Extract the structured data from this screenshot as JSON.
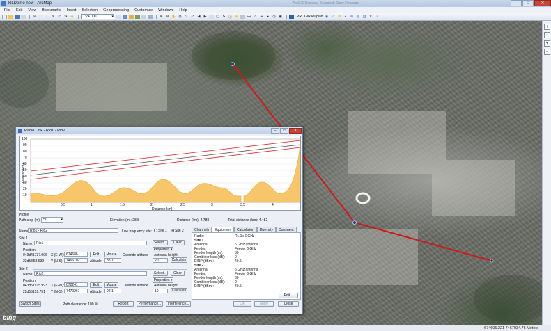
{
  "window": {
    "title": "RLDemo new - ArcMap",
    "faint_title": "ArcGIS Desktop - Microsoft Store Rewards"
  },
  "menu": [
    "File",
    "Edit",
    "View",
    "Bookmarks",
    "Insert",
    "Selection",
    "Geoprocessing",
    "Customize",
    "Windows",
    "Help"
  ],
  "toolbar": {
    "scale": "1:24 000",
    "progira_label": "PROGIRA® plan"
  },
  "status": {
    "coords": "674605.221  7467034.76 Meters"
  },
  "map": {
    "link_color": "#d01818",
    "bing": "bing"
  },
  "dialog": {
    "title": "Radio Link - Rio1 - Rio2",
    "profile": {
      "elev_label": "Elevation(m)",
      "xlabel": "Distance(km)",
      "y_ticks": [
        "100",
        "90",
        "80",
        "70",
        "60",
        "50",
        "40",
        "30",
        "20",
        "10"
      ],
      "x_ticks": [
        "0.5",
        "1",
        "1.5",
        "2",
        "2.5",
        "3",
        "3.5",
        "4"
      ]
    },
    "profile_label": "Profile",
    "path_step_label": "Path step (m):",
    "path_step_value": "50",
    "elevation_text": "Elevation (m): 28.8",
    "distance_text": "Distance (km): 2.788",
    "total_distance_text": "Total distance (km): 4.482",
    "name_label": "Name:",
    "name_value": "Rio1 - Rio2",
    "low_freq_label": "Low frequency site:",
    "site1_radio": "Site 1",
    "site2_radio": "Site 2",
    "site1": {
      "header": "Site 1",
      "name_label": "Name:",
      "name_value": "Rio1",
      "position_label": "Position",
      "coord1": "043d41737.906",
      "coord2": "22d53'53.639",
      "xe_label": "X (E-W):",
      "xe_value": "674686",
      "yn_label": "Y (N-S):",
      "yn_value": "7466702",
      "altitude_label": "Altitude:",
      "altitude_value": "38.1",
      "antenna_height_label": "Antenna height",
      "antenna_height_value": "20"
    },
    "site2": {
      "header": "Site 2",
      "name_label": "Name:",
      "name_value": "Rio2",
      "position_label": "Position",
      "coord1": "043d51915.993",
      "coord2": "22d55159.751",
      "xe_label": "X (E-W):",
      "xe_value": "672241",
      "yn_label": "Y (N-S):",
      "yn_value": "7470267",
      "altitude_label": "Altitude:",
      "altitude_value": "92.1",
      "antenna_height_label": "Antenna height",
      "antenna_height_value": "10"
    },
    "buttons": {
      "select": "Select...",
      "clear": "Clear",
      "properties": "Properties ▾",
      "edit": "Edit",
      "mouse": "Mouse",
      "override_altitude": "Override altitude",
      "calculate": "Calculate",
      "switch_sites": "Switch Sites",
      "report": "Report",
      "performance": "Performance...",
      "interference": "Interference...",
      "ok": "OK",
      "apply": "Apply",
      "close": "Close",
      "edit_dots": "Edit..."
    },
    "path_clearance": "Path clearance:  100 %",
    "tabs": [
      "Channels",
      "Equipment",
      "Calculation",
      "Diversity",
      "Comment"
    ],
    "active_tab": "Equipment",
    "equipment": [
      {
        "label": "Radio:",
        "value": "RL 1x 6 GHz"
      },
      {
        "label": "Site 1",
        "value": "",
        "head": true
      },
      {
        "label": "Antenna:",
        "value": "6 GHz antenna"
      },
      {
        "label": "Feeder:",
        "value": "Feeder 6 GHz"
      },
      {
        "label": "Feeder length (m):",
        "value": "30"
      },
      {
        "label": "Combiner loss (dB):",
        "value": "0"
      },
      {
        "label": "EIRP (dBm):",
        "value": "40.5"
      },
      {
        "label": "Site 2",
        "value": "",
        "head": true
      },
      {
        "label": "Antenna:",
        "value": "6 GHz antenna"
      },
      {
        "label": "Feeder:",
        "value": "Feeder 6 GHz"
      },
      {
        "label": "Feeder length (m):",
        "value": "30"
      },
      {
        "label": "Combiner loss (dB):",
        "value": "0"
      },
      {
        "label": "EIRP (dBm):",
        "value": "40.5"
      }
    ]
  }
}
